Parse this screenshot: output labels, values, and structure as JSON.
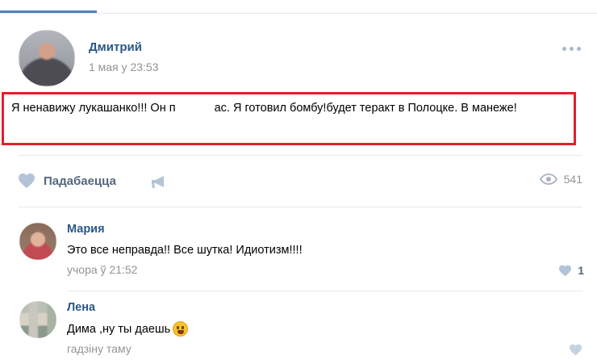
{
  "post": {
    "author": "Дмитрий",
    "date": "1 мая у 23:53",
    "text_part1": "Я ненавижу лукашанко!!! Он п",
    "text_part2": "ас. Я готовил бомбу!будет теракт в Полоцке. В манеже!",
    "like_label": "Падабаецца",
    "views": "541"
  },
  "comments": [
    {
      "name": "Мария",
      "text": "Это все неправда!! Все шутка! Идиотизм!!!!",
      "date": "учора ў 21:52",
      "likes": "1"
    },
    {
      "name": "Лена",
      "text": "Дима ,ну ты даешь",
      "date": "гадзіну таму"
    }
  ],
  "icons": {
    "like": "heart-icon",
    "share": "megaphone-icon",
    "views": "eye-icon",
    "more": "more-dots-icon",
    "emoji": "fearful-face-emoji"
  },
  "colors": {
    "accent": "#2a5885",
    "highlight_border": "#e0202b",
    "muted": "#939393"
  }
}
